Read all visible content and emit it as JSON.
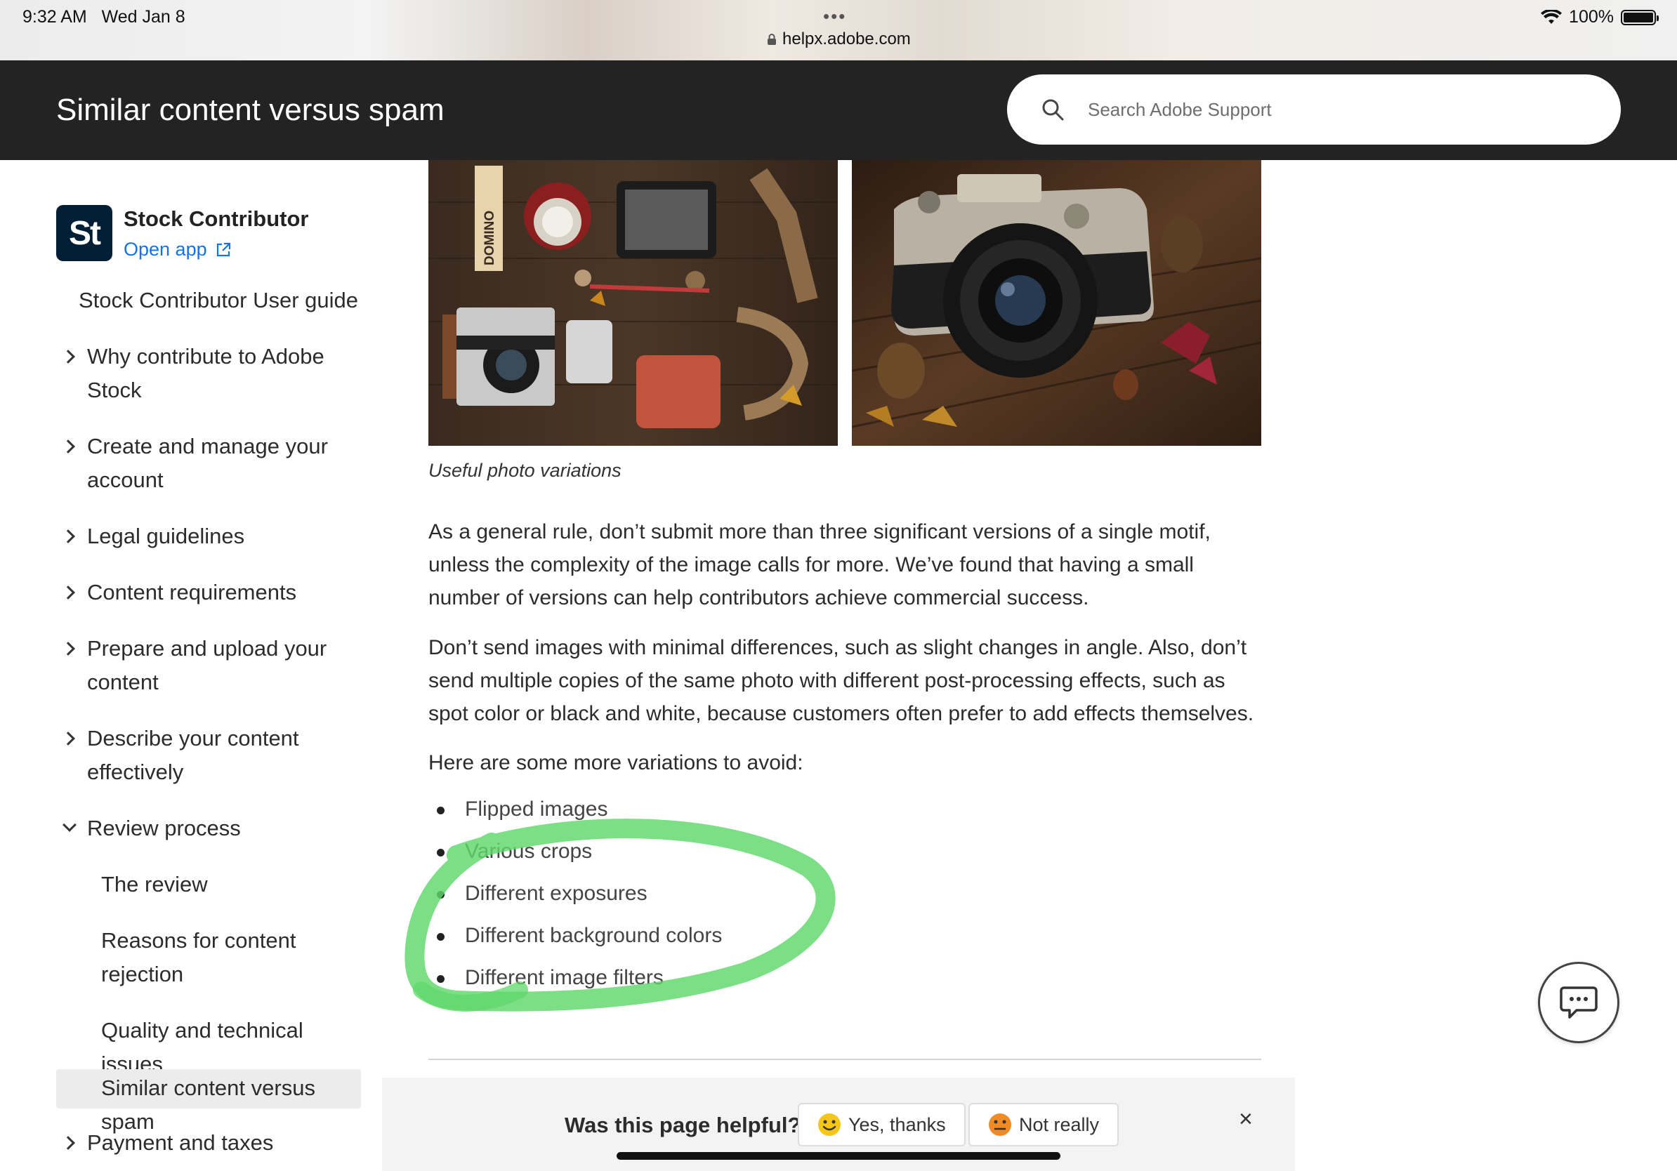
{
  "status_bar": {
    "time": "9:32 AM",
    "date": "Wed Jan 8",
    "url": "helpx.adobe.com",
    "battery": "100%"
  },
  "header": {
    "title": "Similar content versus spam",
    "search_placeholder": "Search Adobe Support"
  },
  "sidebar": {
    "app_name": "Stock Contributor",
    "logo_text": "St",
    "open_app": "Open app",
    "user_guide": "Stock Contributor User guide",
    "items": [
      {
        "label": "Why contribute to Adobe",
        "label2": "Stock"
      },
      {
        "label": "Create and manage your",
        "label2": "account"
      },
      {
        "label": "Legal guidelines"
      },
      {
        "label": "Content requirements"
      },
      {
        "label": "Prepare and upload your",
        "label2": "content"
      },
      {
        "label": "Describe your content",
        "label2": "effectively"
      },
      {
        "label": "Review process"
      },
      {
        "label": "Payment and taxes"
      }
    ],
    "subitems": [
      {
        "label": "The review"
      },
      {
        "label": "Reasons for content",
        "label2": "rejection"
      },
      {
        "label": "Quality and technical issues"
      },
      {
        "label": "Similar content versus spam"
      }
    ]
  },
  "content": {
    "photo_caption": "Useful photo variations",
    "para1": "As a general rule, don’t submit more than three significant versions of a single motif, unless the complexity of the image calls for more. We’ve found that having a small number of versions can help contributors achieve commercial success.",
    "para2": "Don’t send images with minimal differences, such as slight changes in angle. Also, don’t send multiple copies of the same photo with different post-processing effects, such as spot color or black and white, because customers often prefer to add effects themselves.",
    "para3": "Here are some more variations to avoid:",
    "bullets": [
      "Flipped images",
      "Various crops",
      "Different exposures",
      "Different background colors",
      "Different image filters"
    ],
    "domino_label": "DOMINO"
  },
  "feedback": {
    "question": "Was this page helpful?",
    "yes": "Yes, thanks",
    "no": "Not really",
    "close": "×"
  },
  "colors": {
    "header_bg": "#232323",
    "link_blue": "#1473e6",
    "highlight_green": "#5fd86a"
  }
}
